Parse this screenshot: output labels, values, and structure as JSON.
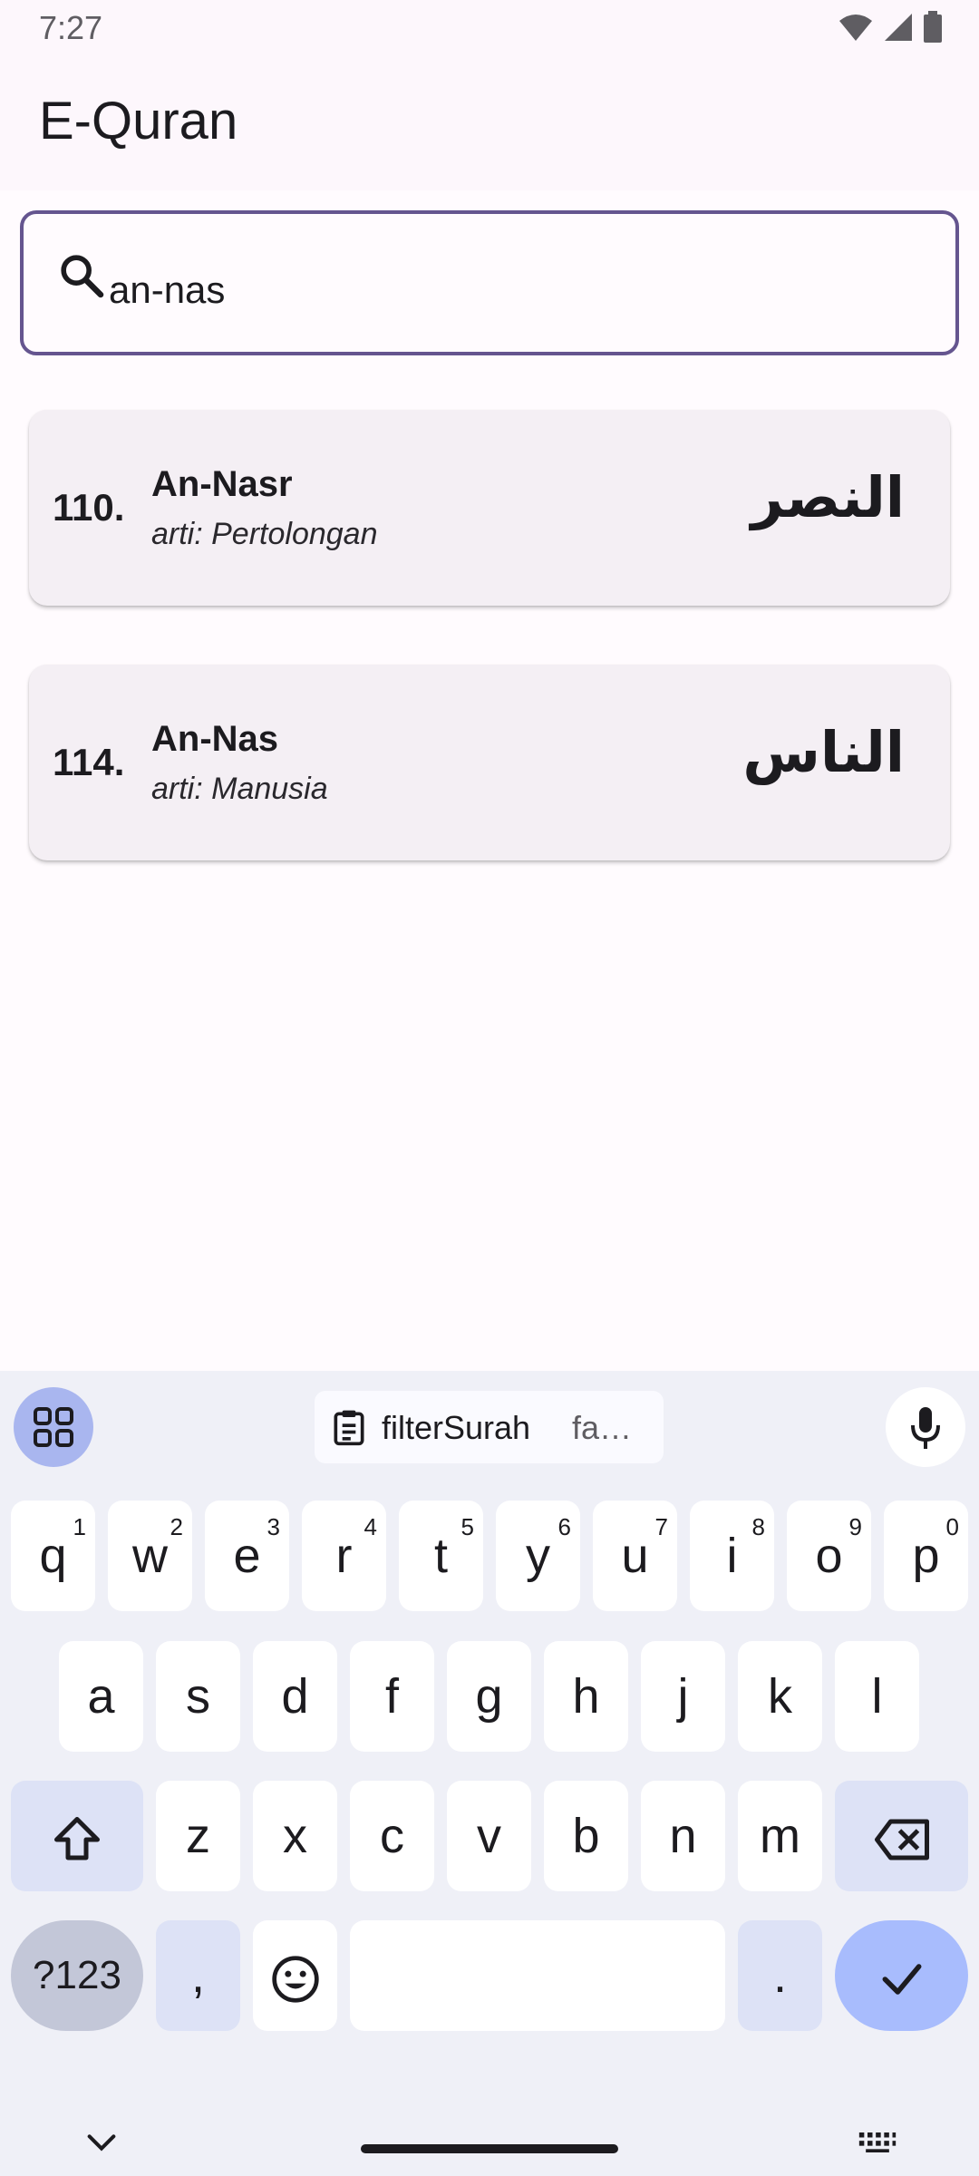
{
  "status": {
    "time": "7:27"
  },
  "app": {
    "title": "E-Quran"
  },
  "search": {
    "value": "an-nas"
  },
  "results": [
    {
      "number": "110.",
      "name": "An-Nasr",
      "meaning": "arti: Pertolongan",
      "arabic": "النصر"
    },
    {
      "number": "114.",
      "name": "An-Nas",
      "meaning": "arti: Manusia",
      "arabic": "الناس"
    }
  ],
  "keyboard": {
    "clipboard_suggestion": "filterSurah",
    "clipboard_more": "fa…",
    "row1": [
      {
        "key": "q",
        "sup": "1"
      },
      {
        "key": "w",
        "sup": "2"
      },
      {
        "key": "e",
        "sup": "3"
      },
      {
        "key": "r",
        "sup": "4"
      },
      {
        "key": "t",
        "sup": "5"
      },
      {
        "key": "y",
        "sup": "6"
      },
      {
        "key": "u",
        "sup": "7"
      },
      {
        "key": "i",
        "sup": "8"
      },
      {
        "key": "o",
        "sup": "9"
      },
      {
        "key": "p",
        "sup": "0"
      }
    ],
    "row2": [
      "a",
      "s",
      "d",
      "f",
      "g",
      "h",
      "j",
      "k",
      "l"
    ],
    "row3": [
      "z",
      "x",
      "c",
      "v",
      "b",
      "n",
      "m"
    ],
    "symbols_label": "?123",
    "comma": ",",
    "period": "."
  },
  "colors": {
    "accent": "#65558f",
    "card_bg": "#f4eff4",
    "keyboard_bg": "#eff0f7",
    "enter_key": "#a8bcfd"
  }
}
